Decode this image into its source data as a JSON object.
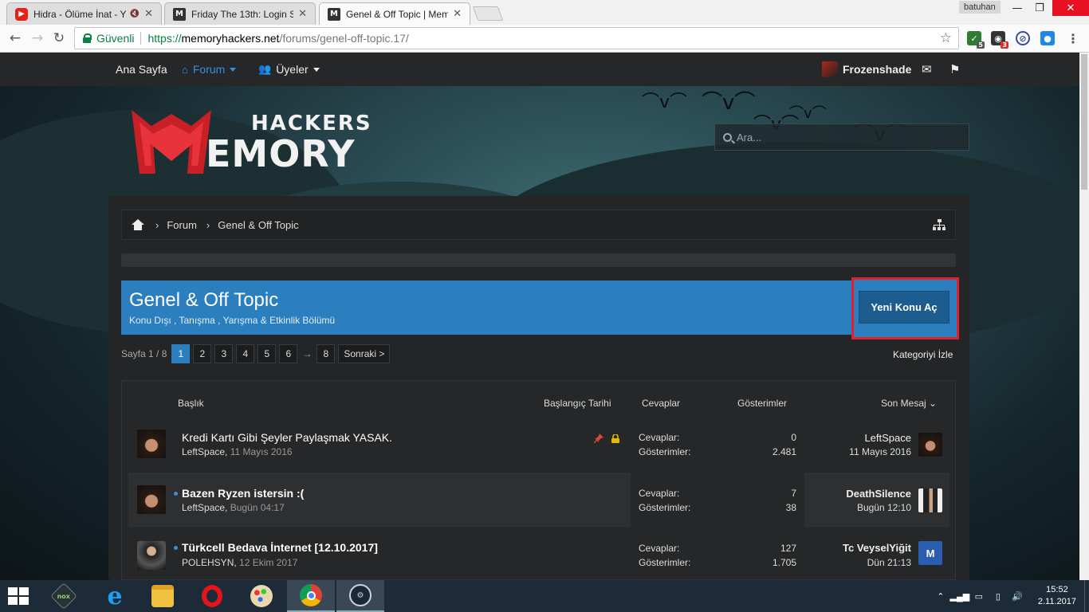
{
  "browser": {
    "tabs": [
      {
        "title": "Hidra - Ölüme İnat - Y",
        "favicon": "youtube-icon",
        "muted_indicator": "◀x"
      },
      {
        "title": "Friday The 13th: Login Sc",
        "favicon": "memoryhackers-icon"
      },
      {
        "title": "Genel & Off Topic | Mem",
        "favicon": "memoryhackers-icon"
      }
    ],
    "profile_name": "batuhan",
    "secure_label": "Güvenli",
    "url": {
      "protocol": "https://",
      "host": "memoryhackers.net",
      "path": "/forums/genel-off-topic.17/"
    },
    "extensions": [
      {
        "name": "shield-extension-icon",
        "badge": "5",
        "color": "#2e7d32"
      },
      {
        "name": "ghostery-extension-icon",
        "badge": "3",
        "color": "#333333"
      },
      {
        "name": "block-extension-icon",
        "badge": "",
        "color": "#3949ab"
      },
      {
        "name": "vpn-extension-icon",
        "badge": "",
        "color": "#1e88e5"
      }
    ]
  },
  "site_nav": {
    "home": "Ana Sayfa",
    "forum": "Forum",
    "members": "Üyeler",
    "username": "Frozenshade"
  },
  "logo": {
    "line1": "HACKERS",
    "line2": "EMORY"
  },
  "search": {
    "placeholder": "Ara..."
  },
  "breadcrumb": {
    "items": [
      "Forum",
      "Genel & Off Topic"
    ]
  },
  "forum": {
    "title": "Genel & Off Topic",
    "description": "Konu Dışı , Tanışma , Yarışma & Etkinlik Bölümü",
    "new_thread": "Yeni Konu Aç",
    "watch": "Kategoriyi İzle"
  },
  "pager": {
    "label": "Sayfa 1 / 8",
    "pages": [
      "1",
      "2",
      "3",
      "4",
      "5",
      "6"
    ],
    "gap": "→",
    "last": "8",
    "next": "Sonraki >"
  },
  "columns": {
    "title": "Başlık",
    "start_date": "Başlangıç Tarihi",
    "replies": "Cevaplar",
    "views": "Gösterimler",
    "last_post": "Son Mesaj ⌄"
  },
  "stat_labels": {
    "replies": "Cevaplar:",
    "views": "Gösterimler:"
  },
  "threads": [
    {
      "title": "Kredi Kartı Gibi Şeyler Paylaşmak YASAK.",
      "author": "LeftSpace",
      "date": "11 Mayıs 2016",
      "replies": "0",
      "views": "2.481",
      "last_user": "LeftSpace",
      "last_date": "11 Mayıs 2016",
      "sticky": true,
      "locked": true
    },
    {
      "title": "Bazen Ryzen istersin :(",
      "author": "LeftSpace",
      "date": "Bugün 04:17",
      "replies": "7",
      "views": "38",
      "last_user": "DeathSilence",
      "last_date": "Bugün 12:10",
      "unread": true
    },
    {
      "title": "Türkcell Bedava İnternet [12.10.2017]",
      "author": "POLEHSYN",
      "date": "12 Ekim 2017",
      "replies": "127",
      "views": "1.705",
      "last_user": "Tc VeyselYiğit",
      "last_date": "Dün 21:13",
      "unread": true
    }
  ],
  "taskbar": {
    "apps": [
      "nox-icon",
      "internet-explorer-icon",
      "file-explorer-icon",
      "opera-icon",
      "paint-icon",
      "chrome-icon",
      "steam-icon"
    ],
    "time": "15:52",
    "date": "2.11.2017"
  },
  "colors": {
    "accent": "#2c7fbf",
    "highlight_border": "#e0202a"
  }
}
